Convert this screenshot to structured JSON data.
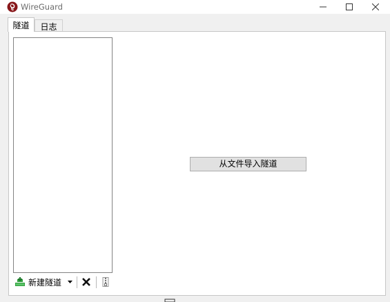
{
  "window": {
    "title": "WireGuard",
    "controls": [
      "minimize-icon",
      "maximize-icon",
      "close-icon"
    ]
  },
  "tabs": [
    {
      "label": "隧道",
      "active": true
    },
    {
      "label": "日志",
      "active": false
    }
  ],
  "tunnel_list": {
    "items": []
  },
  "toolbar": {
    "add_tunnel_label": "新建隧道",
    "add_icon": "add-tunnel-icon",
    "dropdown_icon": "dropdown-arrow-icon",
    "delete_icon": "delete-icon",
    "export_icon": "export-zip-icon"
  },
  "main": {
    "import_button_label": "从文件导入隧道"
  },
  "colors": {
    "app_icon_red": "#88171a",
    "add_icon_green": "#2f9e3c",
    "button_bg": "#e1e1e1",
    "window_bg": "#f0f0f0"
  }
}
